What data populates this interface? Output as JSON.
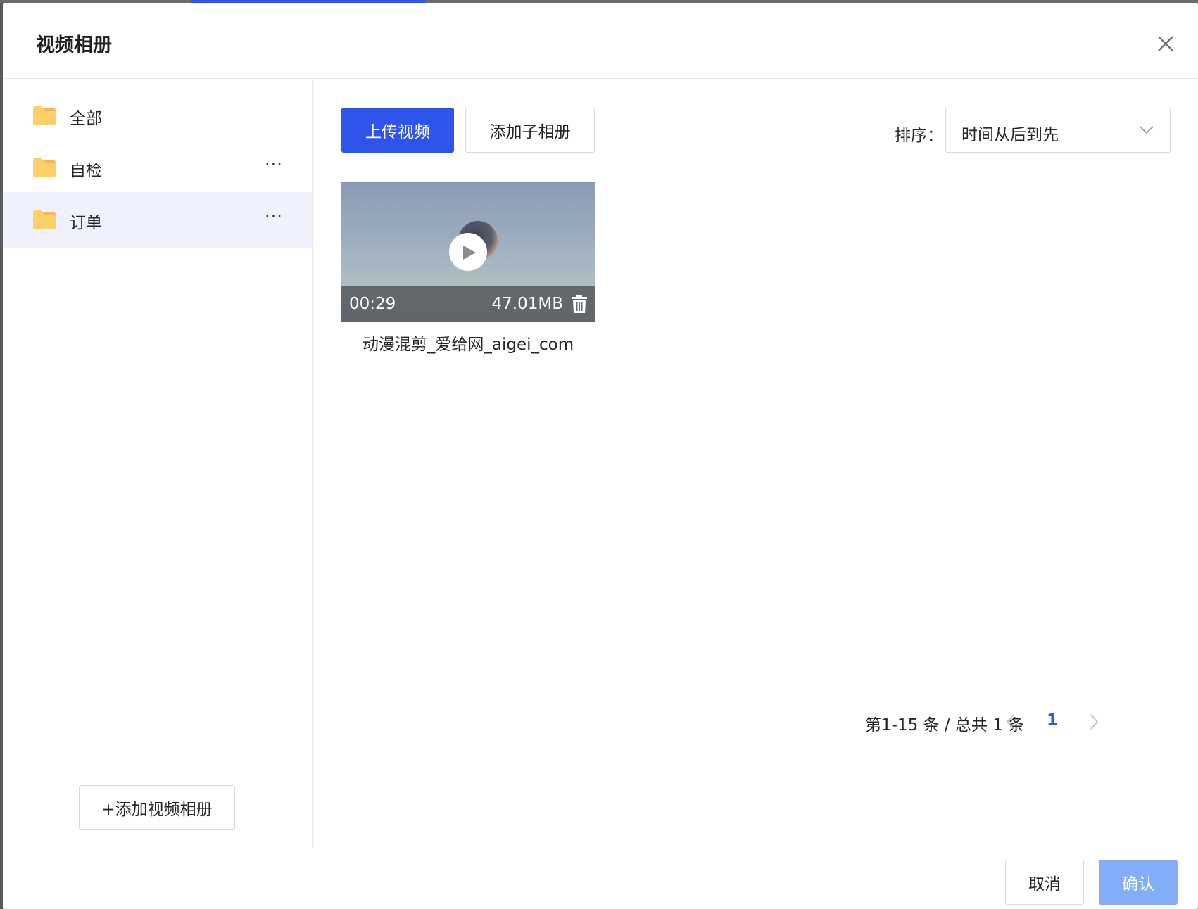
{
  "modal": {
    "title": "视频相册"
  },
  "sidebar": {
    "items": [
      {
        "label": "全部",
        "active": false,
        "has_more": false
      },
      {
        "label": "自检",
        "active": false,
        "has_more": true,
        "more": "···"
      },
      {
        "label": "订单",
        "active": true,
        "has_more": true,
        "more": "···"
      }
    ],
    "add_album_label": "+添加视频相册"
  },
  "toolbar": {
    "upload_label": "上传视频",
    "add_subalbum_label": "添加子相册",
    "sort_label": "排序：",
    "sort_value": "时间从后到先"
  },
  "videos": [
    {
      "duration": "00:29",
      "size": "47.01MB",
      "name": "动漫混剪_爱给网_aigei_com"
    }
  ],
  "pagination": {
    "summary": "第1-15 条 / 总共 1 条",
    "current_page": "1"
  },
  "footer": {
    "cancel_label": "取消",
    "confirm_label": "确认"
  },
  "colors": {
    "primary": "#2f54eb",
    "confirm_disabled": "#84aef7",
    "active_item_bg": "#eff2fd",
    "folder": "#fcd06b"
  }
}
